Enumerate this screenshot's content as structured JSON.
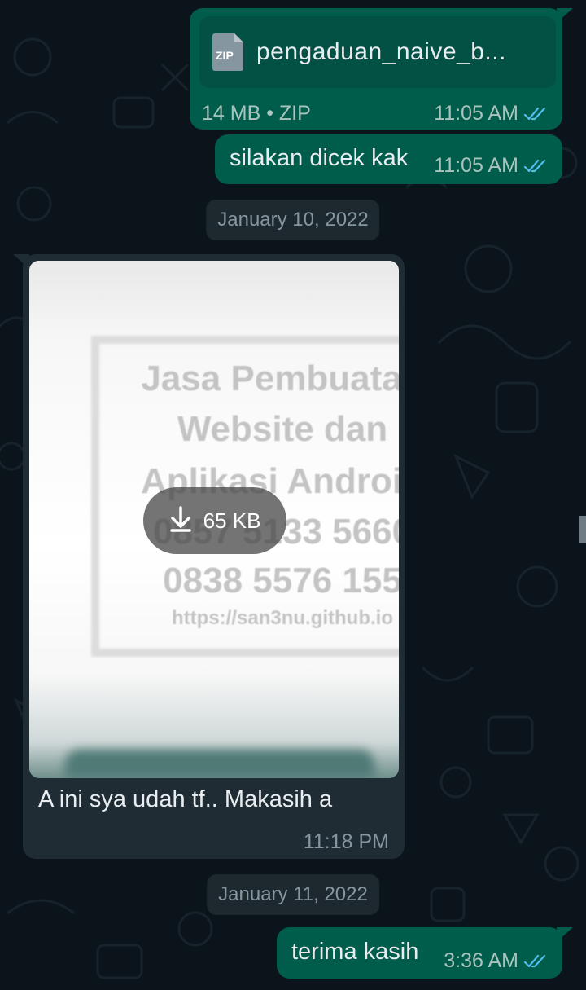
{
  "colors": {
    "background": "#0b141a",
    "outgoing_bubble": "#005c4b",
    "incoming_bubble": "#1f2c34",
    "read_ticks": "#53bdeb",
    "date_pill": "#1d282f"
  },
  "messages": {
    "file_message": {
      "file_type_icon": "zip-file-icon",
      "file_type_label": "ZIP",
      "file_name": "pengaduan_naive_b...",
      "file_info": "14 MB • ZIP",
      "time": "11:05 AM",
      "status_icon": "double-check-read-icon"
    },
    "text_message_1": {
      "text": "silakan dicek kak",
      "time": "11:05 AM",
      "status_icon": "double-check-read-icon"
    },
    "date_separator_1": "January 10, 2022",
    "image_message": {
      "watermark_lines": [
        "Jasa Pembuatan",
        "Website dan",
        "Aplikasi Android",
        "0857 5133 5660",
        "0838 5576 155",
        "https://san3nu.github.io"
      ],
      "download_icon": "download-arrow-icon",
      "download_size": "65 KB",
      "caption": "A ini sya udah tf.. Makasih a",
      "time": "11:18 PM"
    },
    "date_separator_2": "January 11, 2022",
    "text_message_2": {
      "text": "terima kasih",
      "time": "3:36 AM",
      "status_icon": "double-check-read-icon"
    }
  }
}
